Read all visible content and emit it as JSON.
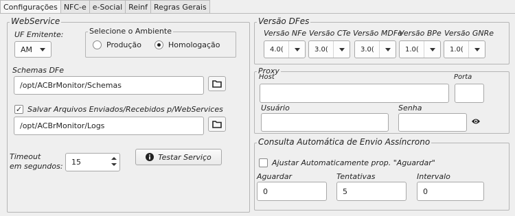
{
  "tabs": [
    "Configurações",
    "NFC-e",
    "e-Social",
    "Reinf",
    "Regras Gerais"
  ],
  "webservice": {
    "title": "WebService",
    "uf_label": "UF Emitente:",
    "uf_value": "AM",
    "ambiente_title": "Selecione o Ambiente",
    "ambiente_options": [
      "Produção",
      "Homologação"
    ],
    "ambiente_selected": "Homologação",
    "schemas_label": "Schemas DFe",
    "schemas_value": "/opt/ACBrMonitor/Schemas",
    "salvar_label": "Salvar Arquivos Enviados/Recebidos p/WebServices",
    "salvar_checked": true,
    "logs_value": "/opt/ACBrMonitor/Logs",
    "timeout_label_1": "Timeout",
    "timeout_label_2": "em segundos:",
    "timeout_value": "15",
    "testar_label": "Testar Serviço"
  },
  "versao": {
    "title": "Versão DFes",
    "labels": [
      "Versão NFe",
      "Versão CTe",
      "Versão MDFe",
      "Versão BPe",
      "Versão GNRe"
    ],
    "values": [
      "4.0(",
      "3.0(",
      "3.0(",
      "1.0(",
      "1.0("
    ]
  },
  "proxy": {
    "title": "Proxy",
    "host_label": "Host",
    "porta_label": "Porta",
    "usuario_label": "Usuário",
    "senha_label": "Senha",
    "host_value": "",
    "porta_value": "",
    "usuario_value": "",
    "senha_value": ""
  },
  "consulta": {
    "title": "Consulta Automática de Envio Assíncrono",
    "ajustar_label": "Ajustar Automaticamente prop. \"Aguardar\"",
    "ajustar_checked": false,
    "aguardar_label": "Aguardar",
    "aguardar_value": "0",
    "tentativas_label": "Tentativas",
    "tentativas_value": "5",
    "intervalo_label": "Intervalo",
    "intervalo_value": "0"
  }
}
